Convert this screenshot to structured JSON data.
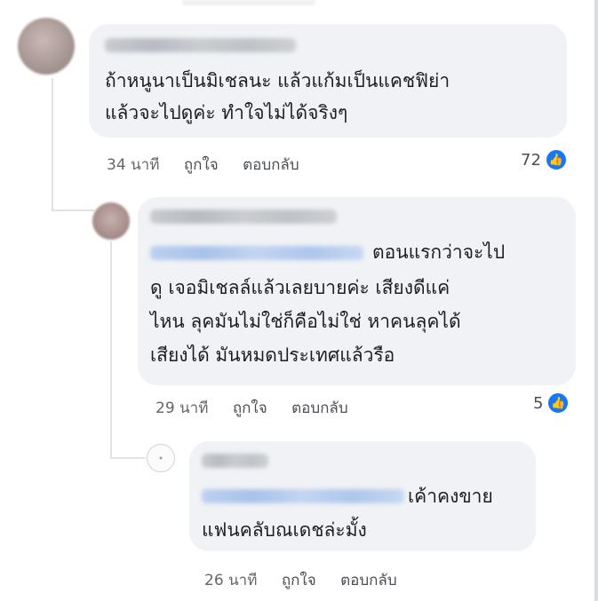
{
  "comments": [
    {
      "text_lines": [
        "ถ้าหนูนาเป็นมิเชลนะ แล้วแก้มเป็นแคชฟิย่า",
        "แล้วจะไปดูค่ะ ทำใจไม่ได้จริงๆ"
      ],
      "time": "34 นาที",
      "like_label": "ถูกใจ",
      "reply_label": "ตอบกลับ",
      "reaction_count": "72"
    },
    {
      "text_lines": [
        "ตอนแรกว่าจะไป",
        "ดู เจอมิเชลล์แล้วเลยบายค่ะ เสียงดีแค่",
        "ไหน ลุคมันไม่ใช่ก็คือไม่ใช่ หาคนลุคได้",
        "เสียงได้ มันหมดประเทศแล้วรือ"
      ],
      "time": "29 นาที",
      "like_label": "ถูกใจ",
      "reply_label": "ตอบกลับ",
      "reaction_count": "5"
    },
    {
      "text_lines": [
        "เค้าคงขาย",
        "แฟนคลับณเดชล่ะมั้ง"
      ],
      "time": "26 นาที",
      "like_label": "ถูกใจ",
      "reply_label": "ตอบกลับ"
    }
  ],
  "icons": {
    "like": "thumbs-up-icon",
    "avatar_placeholder": "emoji-avatar-icon"
  },
  "colors": {
    "bubble": "#f0f2f5",
    "like_blue": "#1877f2",
    "meta_text": "#65676b"
  }
}
